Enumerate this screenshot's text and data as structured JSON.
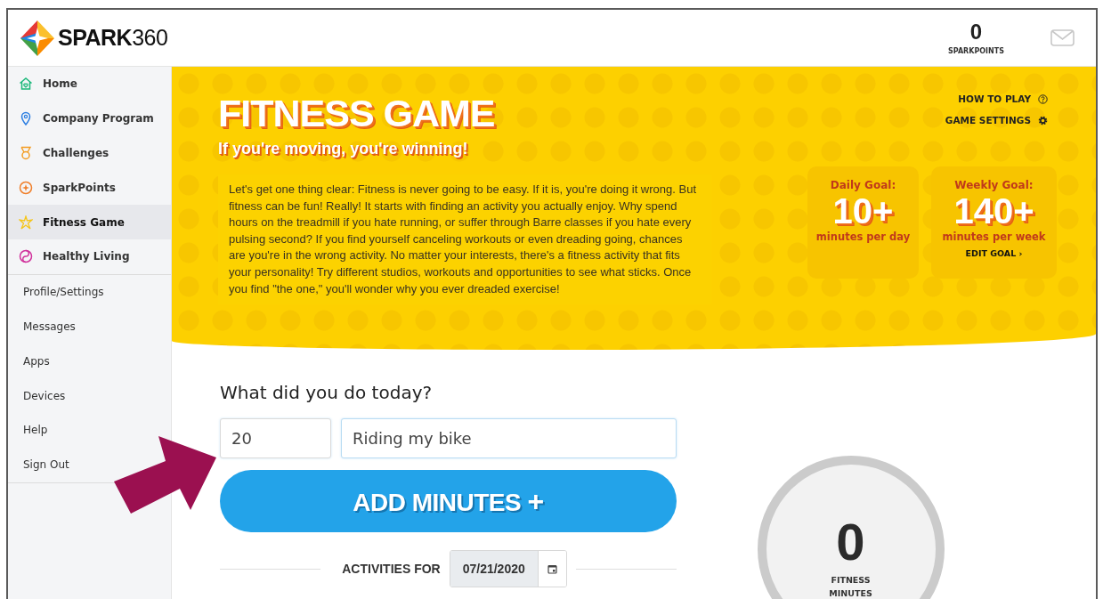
{
  "header": {
    "logo": {
      "bold": "SPARK",
      "light": "360"
    },
    "points": {
      "value": "0",
      "label": "SPARKPOINTS"
    }
  },
  "sidebar": {
    "main_items": [
      {
        "label": "Home",
        "selected": false
      },
      {
        "label": "Company Program",
        "selected": false
      },
      {
        "label": "Challenges",
        "selected": false
      },
      {
        "label": "SparkPoints",
        "selected": false
      },
      {
        "label": "Fitness Game",
        "selected": true
      },
      {
        "label": "Healthy Living",
        "selected": false
      }
    ],
    "account_items": [
      {
        "label": "Profile/Settings",
        "selected": false
      },
      {
        "label": "Messages",
        "selected": false
      },
      {
        "label": "Apps",
        "selected": false
      },
      {
        "label": "Devices",
        "selected": false
      },
      {
        "label": "Help",
        "selected": false
      },
      {
        "label": "Sign Out",
        "selected": false
      }
    ]
  },
  "banner": {
    "title": "FITNESS GAME",
    "subtitle": "If you're moving, you're winning!",
    "intro": "Let's get one thing clear: Fitness is never going to be easy. If it is, you're doing it wrong. But fitness can be fun! Really! It starts with finding an activity you actually enjoy. Why spend hours on the treadmill if you hate running, or suffer through Barre classes if you hate every pulsing second? If you find yourself canceling workouts or even dreading going, chances are you're in the wrong activity. No matter your interests, there's a fitness activity that fits your personality! Try different studios, workouts and opportunities to see what sticks. Once you find \"the one,\" you'll wonder why you ever dreaded exercise!",
    "links": [
      {
        "label": "HOW TO PLAY",
        "kind": "help"
      },
      {
        "label": "GAME SETTINGS",
        "kind": "settings"
      }
    ],
    "goals": [
      {
        "label": "Daily Goal:",
        "value": "10+",
        "unit": "minutes per day"
      },
      {
        "label": "Weekly Goal:",
        "value": "140+",
        "unit": "minutes per week",
        "action": "EDIT GOAL ›"
      }
    ]
  },
  "log": {
    "question": "What did you do today?",
    "minutes": "20",
    "activity": "Riding my bike",
    "button": "ADD MINUTES",
    "button_icon": "+",
    "activities_label": "ACTIVITIES FOR",
    "date": "07/21/2020"
  },
  "summary": {
    "value": "0",
    "label": "FITNESS MINUTES"
  }
}
